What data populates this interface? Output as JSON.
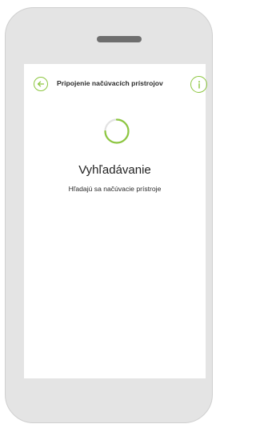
{
  "header": {
    "title": "Pripojenie načúvacích prístrojov",
    "back_icon": "arrow-left-icon",
    "info_icon": "info-icon"
  },
  "status": {
    "title": "Vyhľadávanie",
    "subtitle": "Hľadajú sa načúvacie prístroje"
  },
  "colors": {
    "accent": "#8cc63f",
    "spinner_track": "#e2e2e2",
    "frame": "#e4e4e4",
    "speaker": "#6e6e6e"
  }
}
